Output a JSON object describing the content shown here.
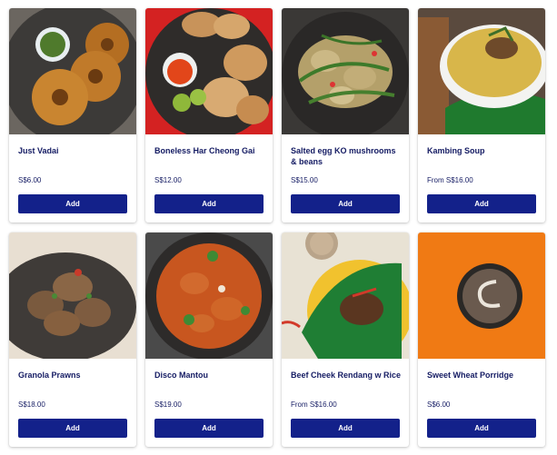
{
  "menu": {
    "items": [
      {
        "name": "Just Vadai",
        "price": "S$6.00",
        "add_label": "Add",
        "photo": "vadai-photo"
      },
      {
        "name": "Boneless Har Cheong Gai",
        "price": "S$12.00",
        "add_label": "Add",
        "photo": "fried-chicken-photo"
      },
      {
        "name": "Salted egg KO mushrooms & beans",
        "price": "S$15.00",
        "add_label": "Add",
        "photo": "salted-egg-mushrooms-photo"
      },
      {
        "name": "Kambing Soup",
        "price": "From S$16.00",
        "add_label": "Add",
        "photo": "kambing-soup-photo"
      },
      {
        "name": "Granola Prawns",
        "price": "S$18.00",
        "add_label": "Add",
        "photo": "granola-prawns-photo"
      },
      {
        "name": "Disco Mantou",
        "price": "S$19.00",
        "add_label": "Add",
        "photo": "disco-mantou-photo"
      },
      {
        "name": "Beef Cheek Rendang w Rice",
        "price": "From S$16.00",
        "add_label": "Add",
        "photo": "beef-rendang-photo"
      },
      {
        "name": "Sweet Wheat Porridge",
        "price": "S$6.00",
        "add_label": "Add",
        "photo": "wheat-porridge-photo"
      }
    ]
  },
  "colors": {
    "title_text": "#141b63",
    "add_button": "#13218a",
    "add_button_text": "#ffffff"
  }
}
